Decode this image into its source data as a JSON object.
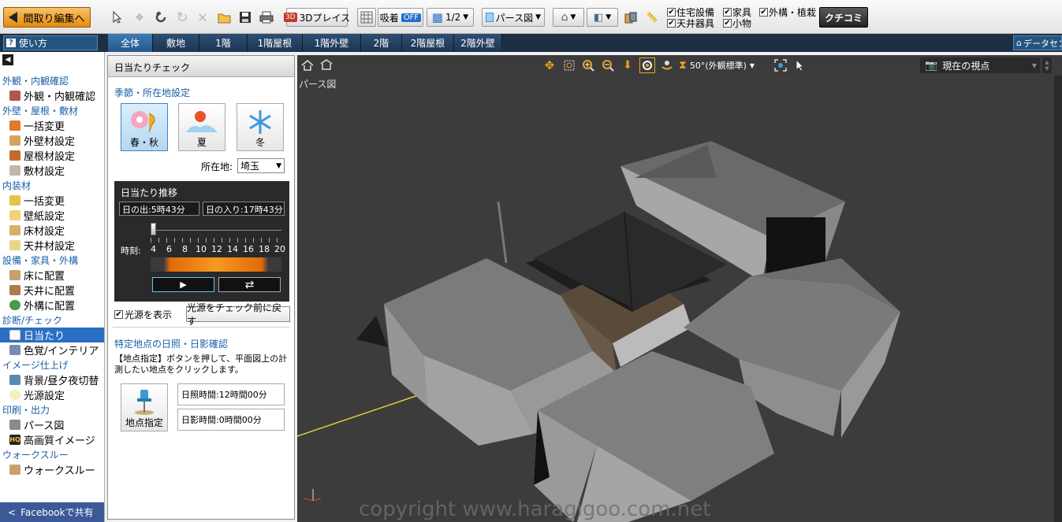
{
  "toolbar": {
    "back_label": "間取り編集へ",
    "place3d_label": "3Dプレイス",
    "snap_label": "吸着",
    "snap_state": "OFF",
    "grid_label": "1/2",
    "view_label": "パース図",
    "checkboxes": [
      {
        "label": "住宅設備",
        "checked": true
      },
      {
        "label": "家具",
        "checked": true
      },
      {
        "label": "外構・植栽",
        "checked": true
      },
      {
        "label": "天井器具",
        "checked": true
      },
      {
        "label": "小物",
        "checked": true
      }
    ],
    "kuchikomi_label": "クチコミ"
  },
  "tabbar": {
    "help_label": "使い方",
    "tabs": [
      "全体",
      "敷地",
      "1階",
      "1階屋根",
      "1階外壁",
      "2階",
      "2階屋根",
      "2階外壁"
    ],
    "active_tab": "全体",
    "datacenter_label": "データセンター"
  },
  "sidebar": {
    "sections": [
      {
        "title": "外観・内観確認",
        "items": [
          "外観・内観確認"
        ]
      },
      {
        "title": "外壁・屋根・敷材",
        "items": [
          "一括変更",
          "外壁材設定",
          "屋根材設定",
          "敷材設定"
        ]
      },
      {
        "title": "内装材",
        "items": [
          "一括変更",
          "壁紙設定",
          "床材設定",
          "天井材設定"
        ]
      },
      {
        "title": "設備・家具・外構",
        "items": [
          "床に配置",
          "天井に配置",
          "外構に配置"
        ]
      },
      {
        "title": "診断/チェック",
        "items": [
          "日当たり",
          "色覚/インテリア"
        ]
      },
      {
        "title": "イメージ仕上げ",
        "items": [
          "背景/昼夕夜切替",
          "光源設定"
        ]
      },
      {
        "title": "印刷・出力",
        "items": [
          "パース図",
          "高画質イメージ"
        ]
      },
      {
        "title": "ウォークスルー",
        "items": [
          "ウォークスルー"
        ]
      }
    ],
    "selected_item": "日当たり",
    "facebook_label": "Facebookで共有"
  },
  "panel": {
    "title": "日当たりチェック",
    "season_heading": "季節・所在地設定",
    "seasons": [
      "春・秋",
      "夏",
      "冬"
    ],
    "selected_season": "春・秋",
    "location_label": "所在地:",
    "location_value": "埼玉",
    "transition_title": "日当たり推移",
    "sunrise": "日の出:5時43分",
    "sunset": "日の入り:17時43分",
    "time_label": "時刻:",
    "ticks": [
      "4",
      "6",
      "8",
      "10",
      "12",
      "14",
      "16",
      "18",
      "20"
    ],
    "slider_position": 0.0,
    "show_light_label": "光源を表示",
    "show_light_checked": true,
    "reset_light_label": "光源をチェック前に戻す",
    "spot_heading": "特定地点の日照・日影確認",
    "spot_desc": "【地点指定】ボタンを押して、平面図上の計測したい地点をクリックします。",
    "spot_button": "地点指定",
    "sun_hours": "日照時間:12時間00分",
    "shade_hours": "日影時間:0時間00分"
  },
  "viewport": {
    "angle_label": "50°(外観標準)",
    "viewpoint_label": "現在の視点",
    "view_title": "パース図",
    "copyright": "copyright www.haragigoo.com.net"
  },
  "colors": {
    "accent": "#2a6fc4",
    "tabbar": "#1e2f45",
    "viewport_bg": "#3c3c3c"
  }
}
